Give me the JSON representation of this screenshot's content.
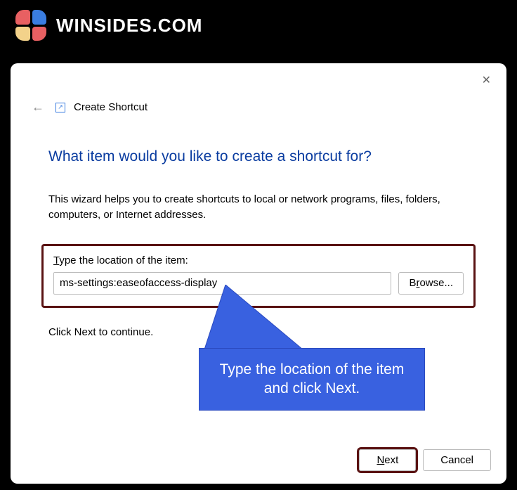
{
  "brand": {
    "text": "WINSIDES.COM"
  },
  "dialog": {
    "title": "Create Shortcut",
    "headline": "What item would you like to create a shortcut for?",
    "description": "This wizard helps you to create shortcuts to local or network programs, files, folders, computers, or Internet addresses.",
    "field_label_pre": "T",
    "field_label_post": "ype the location of the item:",
    "location_value": "ms-settings:easeofaccess-display",
    "browse_pre": "B",
    "browse_u": "r",
    "browse_post": "owse...",
    "continue_text": "Click Next to continue.",
    "next_u": "N",
    "next_post": "ext",
    "cancel": "Cancel"
  },
  "callout": {
    "line1": "Type the location of the item",
    "line2": "and click Next."
  }
}
